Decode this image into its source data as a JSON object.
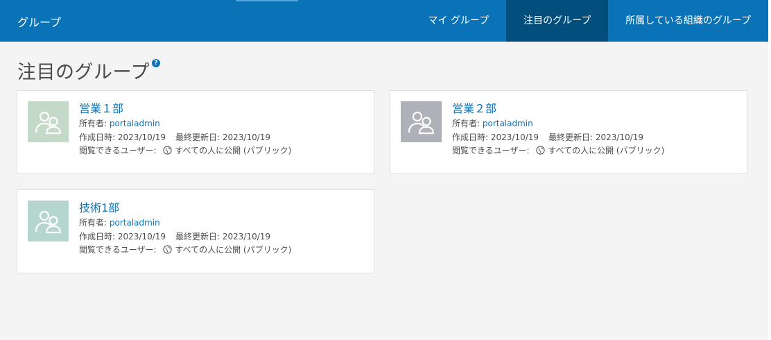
{
  "header": {
    "app_title": "グループ",
    "tabs": [
      {
        "label": "マイ グループ",
        "active": false
      },
      {
        "label": "注目のグループ",
        "active": true
      },
      {
        "label": "所属している組織のグループ",
        "active": false
      }
    ],
    "bar_color": "#0a73b8",
    "active_tab_color": "#024e7d"
  },
  "page": {
    "title": "注目のグループ",
    "help_icon": "question-circle-icon",
    "help_glyph": "?"
  },
  "cards": [
    {
      "title": "営業１部",
      "owner_label": "所有者: ",
      "owner": "portaladmin",
      "created_label": "作成日時: ",
      "created": "2023/10/19",
      "modified_label": "最終更新日: ",
      "modified": "2023/10/19",
      "access_label": "閲覧できるユーザー: ",
      "access": "すべての人に公開 (パブリック)",
      "thumb_color": "#c5d9c8",
      "thumb_icon": "group-users-icon"
    },
    {
      "title": "営業２部",
      "owner_label": "所有者: ",
      "owner": "portaladmin",
      "created_label": "作成日時: ",
      "created": "2023/10/19",
      "modified_label": "最終更新日: ",
      "modified": "2023/10/19",
      "access_label": "閲覧できるユーザー: ",
      "access": "すべての人に公開 (パブリック)",
      "thumb_color": "#b0b1b8",
      "thumb_icon": "group-users-icon"
    },
    {
      "title": "技術1部",
      "owner_label": "所有者: ",
      "owner": "portaladmin",
      "created_label": "作成日時: ",
      "created": "2023/10/19",
      "modified_label": "最終更新日: ",
      "modified": "2023/10/19",
      "access_label": "閲覧できるユーザー: ",
      "access": "すべての人に公開 (パブリック)",
      "thumb_color": "#b5d6cf",
      "thumb_icon": "group-users-icon"
    }
  ]
}
